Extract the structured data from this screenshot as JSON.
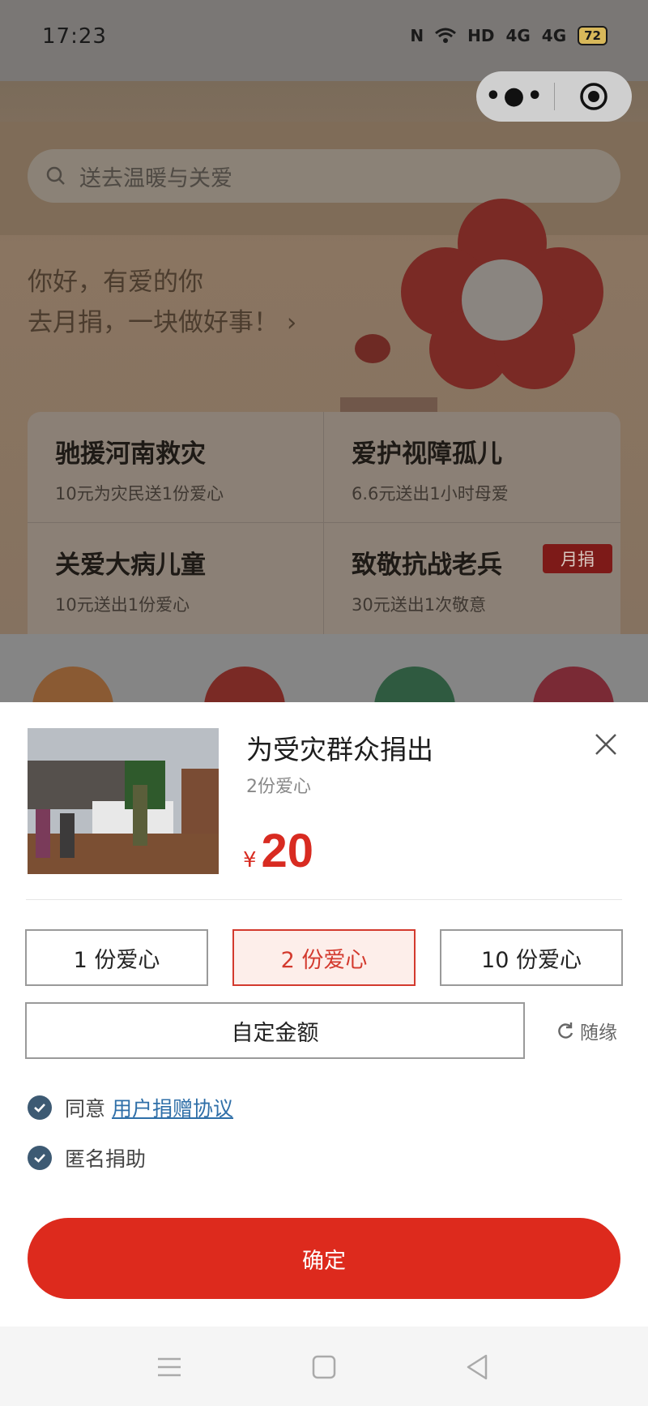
{
  "status_bar": {
    "time": "17:23",
    "network": "HD",
    "signal1": "4G",
    "signal2": "4G",
    "battery": "72"
  },
  "capsule": {
    "more_icon": "more-dots-icon",
    "close_icon": "target-circle-icon"
  },
  "search": {
    "placeholder": "送去温暖与关爱"
  },
  "greeting": {
    "line1": "你好，有爱的你",
    "line2": "去月捐，一块做好事！"
  },
  "cards": [
    {
      "title": "驰援河南救灾",
      "subtitle": "10元为灾民送1份爱心"
    },
    {
      "title": "爱护视障孤儿",
      "subtitle": "6.6元送出1小时母爱"
    },
    {
      "title": "关爱大病儿童",
      "subtitle": "10元送出1份爱心"
    },
    {
      "title": "致敬抗战老兵",
      "subtitle": "30元送出1次敬意",
      "tag": "月捐"
    }
  ],
  "sheet": {
    "title": "为受灾群众捐出",
    "subtitle": "2份爱心",
    "currency": "¥",
    "amount": "20",
    "options": [
      "1 份爱心",
      "2 份爱心",
      "10 份爱心"
    ],
    "selected_option": 1,
    "custom_label": "自定金额",
    "random_label": "随缘",
    "agree_prefix": "同意",
    "agree_link": "用户捐赠协议",
    "anonymous_label": "匿名捐助",
    "confirm_label": "确定"
  },
  "colors": {
    "accent": "#dd2a1d",
    "link": "#2f6fa8",
    "check": "#3d5a73"
  }
}
